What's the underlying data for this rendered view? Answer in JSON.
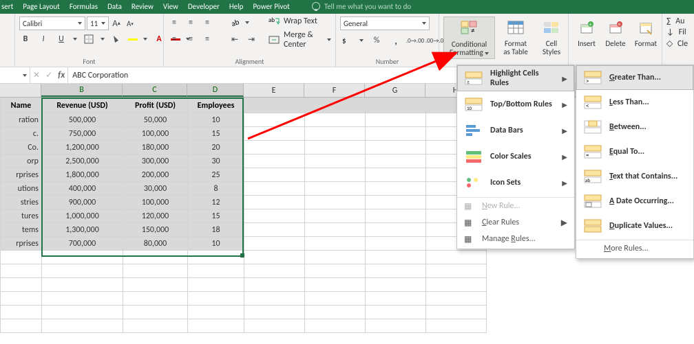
{
  "menubar": [
    "sert",
    "Page Layout",
    "Formulas",
    "Data",
    "Review",
    "View",
    "Developer",
    "Help",
    "Power Pivot"
  ],
  "tellme": "Tell me what you want to do",
  "ribbon": {
    "font": {
      "label": "Font",
      "name": "Calibri",
      "size": "11"
    },
    "alignment": {
      "label": "Alignment",
      "wrap": "Wrap Text",
      "merge": "Merge & Center"
    },
    "number": {
      "label": "Number",
      "format": "General"
    },
    "styles": {
      "cond": "Conditional Formatting",
      "cond_sub": "▾",
      "table": "Format as Table",
      "cell": "Cell Styles"
    },
    "cells": {
      "insert": "Insert",
      "delete": "Delete",
      "format": "Format"
    },
    "editing": {
      "au": "Au",
      "fil": "Fil",
      "cle": "Cle"
    }
  },
  "formula_bar": {
    "value": "ABC Corporation"
  },
  "columns": [
    "B",
    "C",
    "D",
    "E",
    "F",
    "G",
    "H"
  ],
  "table": {
    "headers": [
      "Name",
      "Revenue (USD)",
      "Profit (USD)",
      "Employees"
    ],
    "rows": [
      [
        "ration",
        "500,000",
        "50,000",
        "10"
      ],
      [
        "c.",
        "750,000",
        "100,000",
        "15"
      ],
      [
        "Co.",
        "1,200,000",
        "180,000",
        "20"
      ],
      [
        "orp",
        "2,500,000",
        "300,000",
        "30"
      ],
      [
        "rprises",
        "1,800,000",
        "200,000",
        "25"
      ],
      [
        "utions",
        "400,000",
        "30,000",
        "8"
      ],
      [
        "stries",
        "900,000",
        "100,000",
        "12"
      ],
      [
        "tures",
        "1,000,000",
        "120,000",
        "15"
      ],
      [
        "tems",
        "1,300,000",
        "150,000",
        "18"
      ],
      [
        "rprises",
        "700,000",
        "80,000",
        "10"
      ]
    ]
  },
  "cf_menu": {
    "highlight": "Highlight Cells Rules",
    "topbottom": "Top/Bottom Rules",
    "databars": "Data Bars",
    "colorscales": "Color Scales",
    "iconsets": "Icon Sets",
    "newrule": "New Rule...",
    "clear": "Clear Rules",
    "manage": "Manage Rules..."
  },
  "hcr_menu": {
    "greater": "Greater Than...",
    "less": "Less Than...",
    "between": "Between...",
    "equal": "Equal To...",
    "textcontains": "Text that Contains...",
    "dateoccurring": "A Date Occurring...",
    "duplicate": "Duplicate Values...",
    "more": "More Rules..."
  },
  "chart_data": {
    "type": "table",
    "title": "",
    "columns": [
      "Name",
      "Revenue (USD)",
      "Profit (USD)",
      "Employees"
    ],
    "rows": [
      [
        "ration",
        500000,
        50000,
        10
      ],
      [
        "c.",
        750000,
        100000,
        15
      ],
      [
        "Co.",
        1200000,
        180000,
        20
      ],
      [
        "orp",
        2500000,
        300000,
        30
      ],
      [
        "rprises",
        1800000,
        200000,
        25
      ],
      [
        "utions",
        400000,
        30000,
        8
      ],
      [
        "stries",
        900000,
        100000,
        12
      ],
      [
        "tures",
        1000000,
        120000,
        15
      ],
      [
        "tems",
        1300000,
        150000,
        18
      ],
      [
        "rprises",
        700000,
        80000,
        10
      ]
    ]
  }
}
